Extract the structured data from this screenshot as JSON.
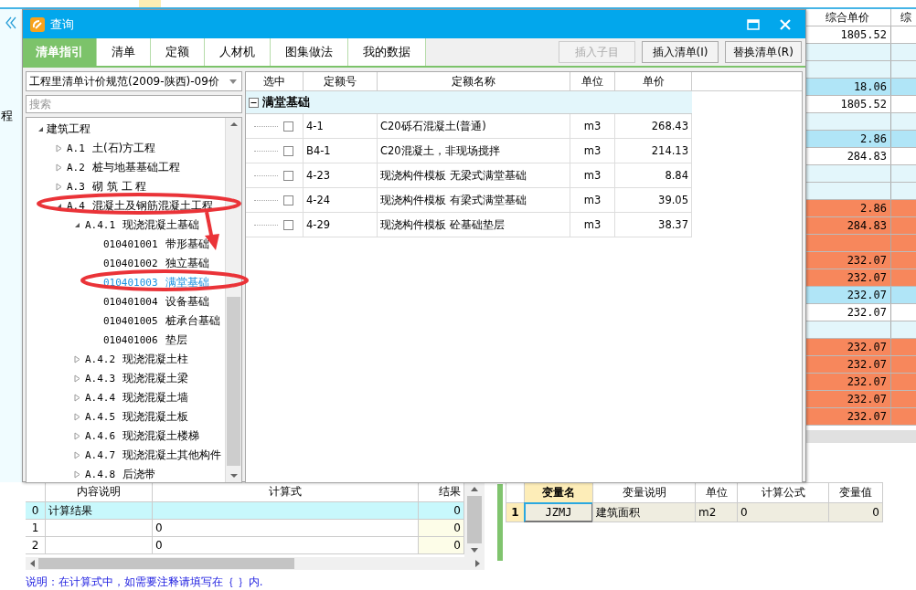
{
  "app": {
    "side_label": "程",
    "columns": [
      "综合单价",
      "综"
    ],
    "rows": [
      {
        "value": "1805.52",
        "color": "#ffffff"
      },
      {
        "color": "#e3f6fb"
      },
      {
        "color": "#e3f6fb"
      },
      {
        "value": "18.06",
        "color": "#b0e5f7"
      },
      {
        "value": "1805.52",
        "color": "#ffffff"
      },
      {
        "color": "#e3f6fb"
      },
      {
        "value": "2.86",
        "color": "#b0e5f7"
      },
      {
        "value": "284.83",
        "color": "#ffffff"
      },
      {
        "color": "#e3f6fb"
      },
      {
        "color": "#e3f6fb"
      },
      {
        "value": "2.86",
        "color": "#f7875c"
      },
      {
        "value": "284.83",
        "color": "#f7875c"
      },
      {
        "color": "#f7875c"
      },
      {
        "value": "232.07",
        "color": "#f7875c"
      },
      {
        "value": "232.07",
        "color": "#f7875c"
      },
      {
        "value": "232.07",
        "color": "#b0e5f7"
      },
      {
        "value": "232.07",
        "color": "#ffffff"
      },
      {
        "color": "#e3f6fb"
      },
      {
        "value": "232.07",
        "color": "#f7875c"
      },
      {
        "value": "232.07",
        "color": "#f7875c"
      },
      {
        "value": "232.07",
        "color": "#f7875c"
      },
      {
        "value": "232.07",
        "color": "#f7875c"
      },
      {
        "value": "232.07",
        "color": "#f7875c"
      }
    ]
  },
  "dialog": {
    "title": "查询",
    "tabs": [
      {
        "label": "清单指引",
        "selected": true
      },
      {
        "label": "清单",
        "selected": false
      },
      {
        "label": "定额",
        "selected": false
      },
      {
        "label": "人材机",
        "selected": false
      },
      {
        "label": "图集做法",
        "selected": false
      },
      {
        "label": "我的数据",
        "selected": false
      }
    ],
    "buttons": [
      {
        "label": "插入子目",
        "disabled": true
      },
      {
        "label": "插入清单(I)",
        "disabled": false
      },
      {
        "label": "替换清单(R)",
        "disabled": false
      }
    ],
    "library": {
      "value": "工程里清单计价规范(2009-陕西)-09价"
    },
    "search": {
      "placeholder": "搜索"
    },
    "tree": [
      {
        "name": "建筑工程",
        "expanded": true,
        "selected": false,
        "children": [
          {
            "code": "A.1",
            "name": "土(石)方工程",
            "expanded": false,
            "selected": false
          },
          {
            "code": "A.2",
            "name": "桩与地基基础工程",
            "expanded": false,
            "selected": false
          },
          {
            "code": "A.3",
            "name": "砌 筑 工 程",
            "expanded": false,
            "selected": false
          },
          {
            "code": "A.4",
            "name": "混凝土及钢筋混凝土工程",
            "expanded": true,
            "selected": false,
            "children": [
              {
                "code": "A.4.1",
                "name": "现浇混凝土基础",
                "expanded": true,
                "selected": false,
                "children": [
                  {
                    "code": "010401001",
                    "name": "带形基础",
                    "selected": false
                  },
                  {
                    "code": "010401002",
                    "name": "独立基础",
                    "selected": false
                  },
                  {
                    "code": "010401003",
                    "name": "满堂基础",
                    "selected": true
                  },
                  {
                    "code": "010401004",
                    "name": "设备基础",
                    "selected": false
                  },
                  {
                    "code": "010401005",
                    "name": "桩承台基础",
                    "selected": false
                  },
                  {
                    "code": "010401006",
                    "name": "垫层",
                    "selected": false
                  }
                ]
              },
              {
                "code": "A.4.2",
                "name": "现浇混凝土柱",
                "expanded": false,
                "selected": false
              },
              {
                "code": "A.4.3",
                "name": "现浇混凝土梁",
                "expanded": false,
                "selected": false
              },
              {
                "code": "A.4.4",
                "name": "现浇混凝土墙",
                "expanded": false,
                "selected": false
              },
              {
                "code": "A.4.5",
                "name": "现浇混凝土板",
                "expanded": false,
                "selected": false
              },
              {
                "code": "A.4.6",
                "name": "现浇混凝土楼梯",
                "expanded": false,
                "selected": false
              },
              {
                "code": "A.4.7",
                "name": "现浇混凝土其他构件",
                "expanded": false,
                "selected": false
              },
              {
                "code": "A.4.8",
                "name": "后浇带",
                "expanded": false,
                "selected": false
              }
            ]
          }
        ]
      }
    ],
    "quota_table": {
      "columns": [
        "选中",
        "定额号",
        "定额名称",
        "单位",
        "单价"
      ],
      "group": {
        "label": "满堂基础",
        "expanded": true
      },
      "rows": [
        {
          "checked": false,
          "code": "4-1",
          "name": "C20砾石混凝土(普通)",
          "unit": "m3",
          "price": "268.43"
        },
        {
          "checked": false,
          "code": "B4-1",
          "name": "C20混凝土，非现场搅拌",
          "unit": "m3",
          "price": "214.13"
        },
        {
          "checked": false,
          "code": "4-23",
          "name": "现浇构件模板 无梁式满堂基础",
          "unit": "m3",
          "price": "8.84"
        },
        {
          "checked": false,
          "code": "4-24",
          "name": "现浇构件模板 有梁式满堂基础",
          "unit": "m3",
          "price": "39.05"
        },
        {
          "checked": false,
          "code": "4-29",
          "name": "现浇构件模板 砼基础垫层",
          "unit": "m3",
          "price": "38.37"
        }
      ]
    }
  },
  "formula_table": {
    "columns": [
      "内容说明",
      "计算式",
      "结果"
    ],
    "rows": [
      {
        "index": "0",
        "description": "计算结果",
        "result": "0",
        "kind": "total"
      },
      {
        "index": "1",
        "formula": "0",
        "result": "0",
        "kind": "item"
      },
      {
        "index": "2",
        "formula": "0",
        "result": "0",
        "kind": "item"
      }
    ]
  },
  "variable_table": {
    "columns": [
      "变量名",
      "变量说明",
      "单位",
      "计算公式",
      "变量值"
    ],
    "rows": [
      {
        "index": "1",
        "name": "JZMJ",
        "description": "建筑面积",
        "unit": "m2",
        "formula": "0",
        "value": "0",
        "selected": true
      }
    ]
  },
  "note": "说明：在计算式中，如需要注释请填写在｛ ｝内."
}
